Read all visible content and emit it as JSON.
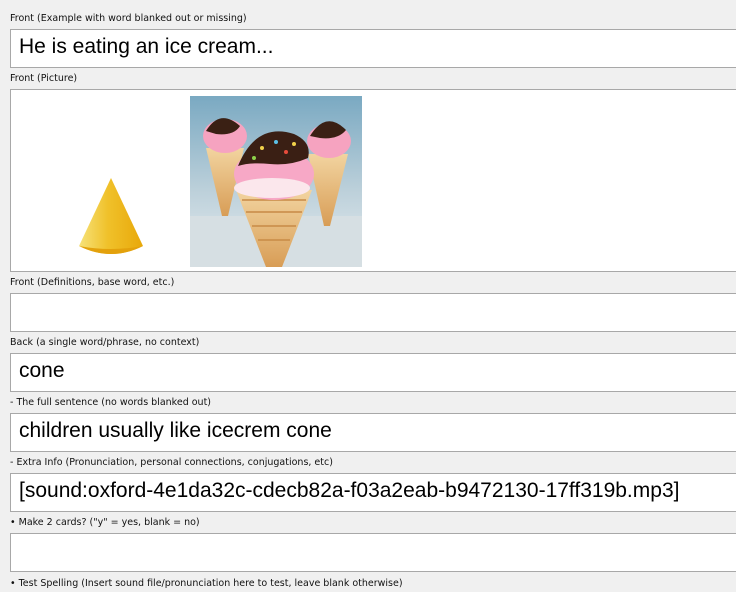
{
  "fields": [
    {
      "label": "Front (Example with word blanked out or missing)",
      "value": "He is eating an ice cream..."
    },
    {
      "label": "Front (Picture)",
      "value": ""
    },
    {
      "label": "Front (Definitions, base word, etc.)",
      "value": ""
    },
    {
      "label": "Back (a single word/phrase, no context)",
      "value": "cone"
    },
    {
      "label": "- The full sentence (no words blanked out)",
      "value": "children usually like icecrem cone"
    },
    {
      "label": "- Extra Info (Pronunciation, personal connections, conjugations, etc)",
      "value": "[sound:oxford-4e1da32c-cdecb82a-f03a2eab-b9472130-17ff319b.mp3]"
    },
    {
      "label": "• Make 2 cards? (\"y\" = yes, blank = no)",
      "value": ""
    },
    {
      "label": "• Test Spelling (Insert sound file/pronunciation here to test, leave blank otherwise)",
      "value": ""
    }
  ]
}
